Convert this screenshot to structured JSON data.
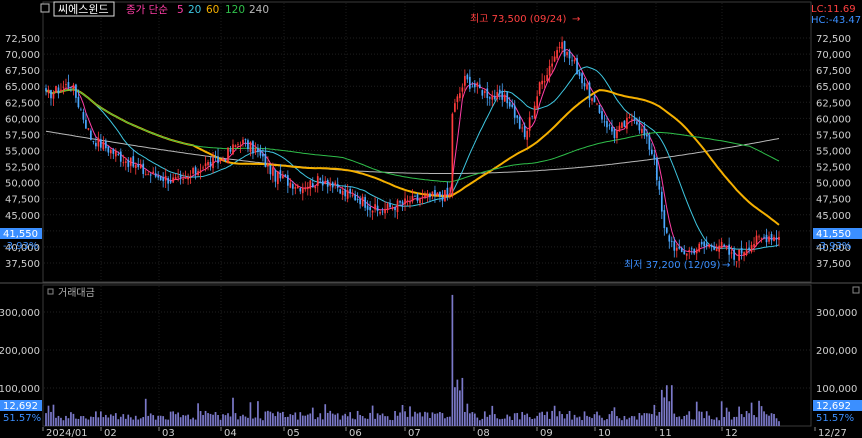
{
  "header": {
    "menu_icon": "box-menu-icon",
    "stock_name": "씨에스윈드",
    "ma_label": "종가 단순",
    "ma_periods": [
      "5",
      "20",
      "60",
      "120",
      "240"
    ],
    "lc_label": "LC:11.69",
    "hc_label": "HC:-43.47"
  },
  "colors": {
    "up": "#ff3b3b",
    "down": "#4aa8ff",
    "ma5": "#ff3ea6",
    "ma20": "#3ec6e0",
    "ma60": "#f5b000",
    "ma120": "#2fbf4a",
    "ma240": "#b8b8b8",
    "volume": "#7b79c9",
    "current": "#3b8fff"
  },
  "price_panel": {
    "y_ticks": [
      "72,500",
      "70,000",
      "67,500",
      "65,000",
      "62,500",
      "60,000",
      "57,500",
      "55,000",
      "52,500",
      "50,000",
      "47,500",
      "45,000",
      "42,500",
      "40,000",
      "37,500"
    ],
    "current_price": "41,550",
    "current_change": "-3.93%",
    "high_note": "최고 73,500 (09/24)",
    "low_note": "최저 37,200 (12/09)"
  },
  "volume_panel": {
    "title": "거래대금",
    "y_ticks": [
      "300,000",
      "200,000",
      "100,000"
    ],
    "current_value": "12,692",
    "current_ratio": "51.57%"
  },
  "x_axis": {
    "labels": [
      "2024/01",
      "02",
      "03",
      "04",
      "05",
      "06",
      "07",
      "08",
      "09",
      "10",
      "11",
      "12",
      "12/27"
    ]
  },
  "chart_data": {
    "type": "candlestick",
    "period": "2024/01 - 12/27",
    "monthly_closes": {
      "x": [
        "01",
        "02",
        "03",
        "04",
        "05",
        "06",
        "07",
        "08",
        "09",
        "10",
        "11",
        "12"
      ],
      "close": [
        56000,
        52000,
        50500,
        55000,
        51000,
        50500,
        47000,
        64000,
        70500,
        60000,
        39000,
        41550
      ]
    },
    "moving_averages": [
      {
        "name": "5",
        "end_value": 41550
      },
      {
        "name": "20",
        "end_value": 41000
      },
      {
        "name": "60",
        "end_value": 49000
      },
      {
        "name": "120",
        "end_value": 53500
      },
      {
        "name": "240",
        "end_value": 53500
      }
    ],
    "high": 73500,
    "low": 37200,
    "volume_peak": 345000,
    "y_range_price": [
      35000,
      74000
    ],
    "y_range_volume": [
      0,
      360000
    ]
  }
}
